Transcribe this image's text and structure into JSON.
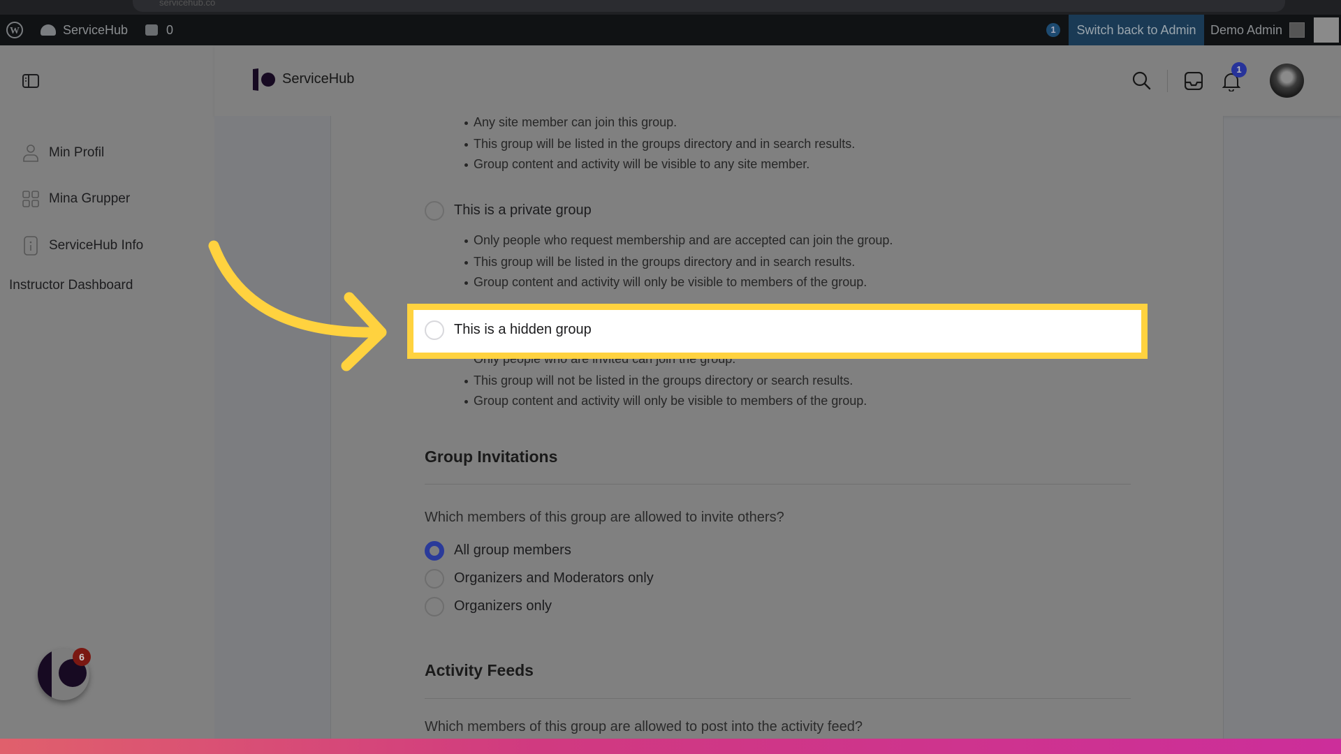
{
  "browser": {
    "url": "servicehub.co"
  },
  "admin_bar": {
    "site_name": "ServiceHub",
    "comments_count": "0",
    "updates_count": "1",
    "switch_back": "Switch back to Admin",
    "user": "Demo Admin"
  },
  "header": {
    "brand": "ServiceHub",
    "notifications_count": "1"
  },
  "sidebar": {
    "items": [
      {
        "label": "Min Profil",
        "icon": "user-icon"
      },
      {
        "label": "Mina Grupper",
        "icon": "grid-icon"
      },
      {
        "label": "ServiceHub Info",
        "icon": "info-icon"
      }
    ],
    "instructor": "Instructor Dashboard"
  },
  "privacy": {
    "public_bullets": [
      "Any site member can join this group.",
      "This group will be listed in the groups directory and in search results.",
      "Group content and activity will be visible to any site member."
    ],
    "private_label": "This is a private group",
    "private_bullets": [
      "Only people who request membership and are accepted can join the group.",
      "This group will be listed in the groups directory and in search results.",
      "Group content and activity will only be visible to members of the group."
    ],
    "hidden_label": "This is a hidden group",
    "hidden_bullets": [
      "Only people who are invited can join the group.",
      "This group will not be listed in the groups directory or search results.",
      "Group content and activity will only be visible to members of the group."
    ]
  },
  "invitations": {
    "title": "Group Invitations",
    "question": "Which members of this group are allowed to invite others?",
    "options": [
      "All group members",
      "Organizers and Moderators only",
      "Organizers only"
    ],
    "selected": "All group members"
  },
  "activity": {
    "title": "Activity Feeds",
    "question": "Which members of this group are allowed to post into the activity feed?"
  },
  "floating": {
    "badge": "6"
  },
  "colors": {
    "highlight": "#ffd23f",
    "accent": "#2a3a9a",
    "brand": "#170a22",
    "switch_bg": "#1a3a55"
  }
}
